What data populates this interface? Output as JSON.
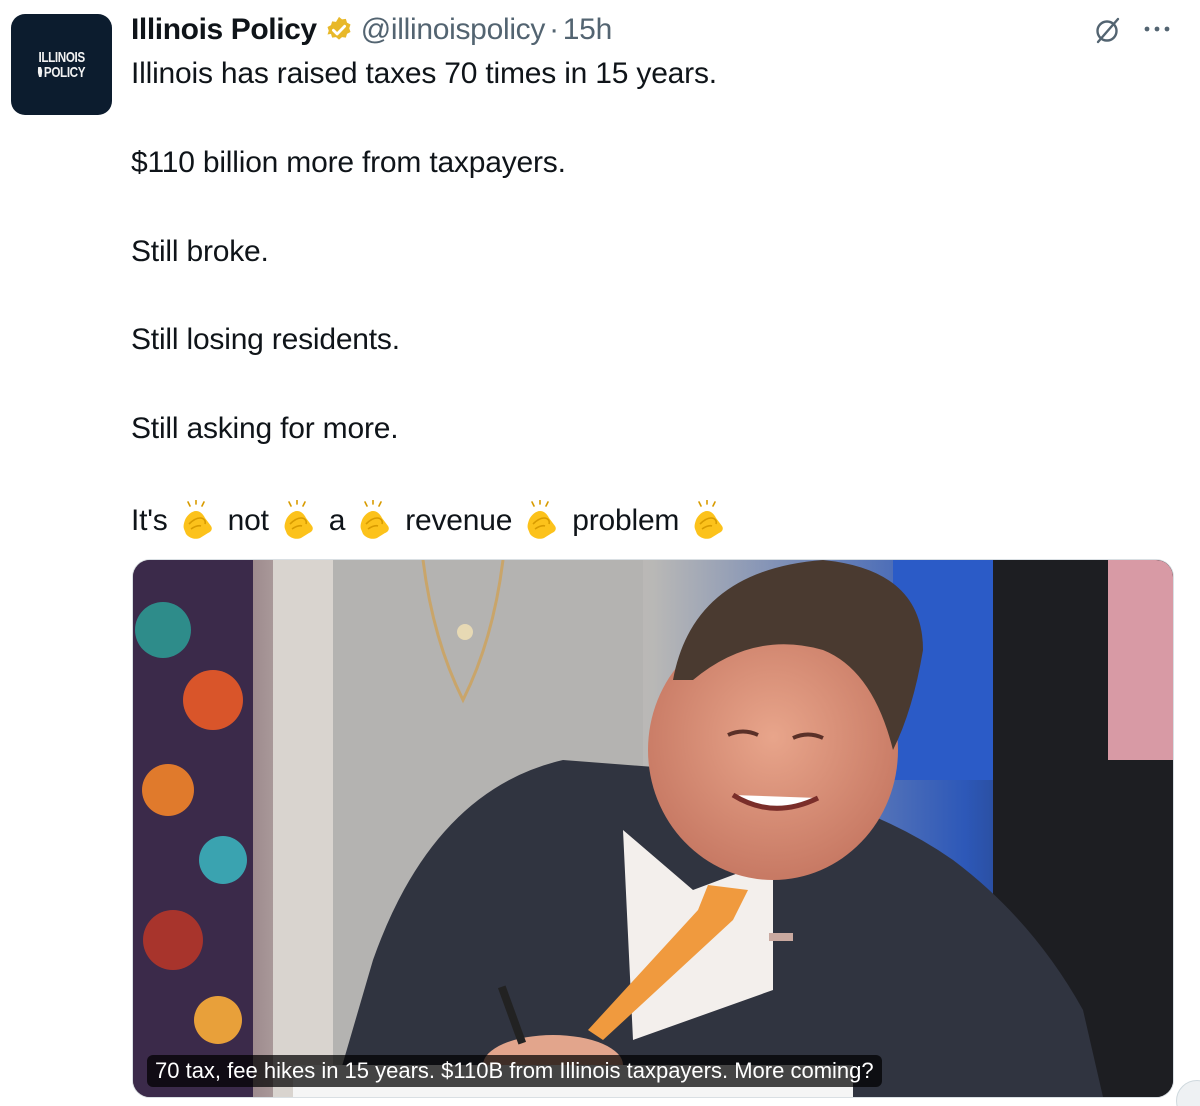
{
  "author": {
    "name": "Illinois Policy",
    "handle": "@illinoispolicy",
    "separator": "·",
    "time": "15h",
    "avatar_line1": "ILLINOIS",
    "avatar_line2": "POLICY",
    "verified_color": "#e8b829"
  },
  "tweet": {
    "line1": "Illinois has raised taxes 70 times in 15 years.",
    "line2": "$110 billion more from taxpayers.",
    "line3": "Still broke.",
    "line4": "Still losing residents.",
    "line5": "Still asking for more.",
    "clap_words": [
      "It's",
      "not",
      "a",
      "revenue",
      "problem"
    ]
  },
  "media": {
    "caption": "70 tax, fee hikes in 15 years. $110B from Illinois taxpayers. More coming?"
  },
  "icons": {
    "badge": "verified-gold-badge-icon",
    "grok": "grok-icon",
    "more": "more-options-icon",
    "clap": "clapping-hands-emoji"
  }
}
